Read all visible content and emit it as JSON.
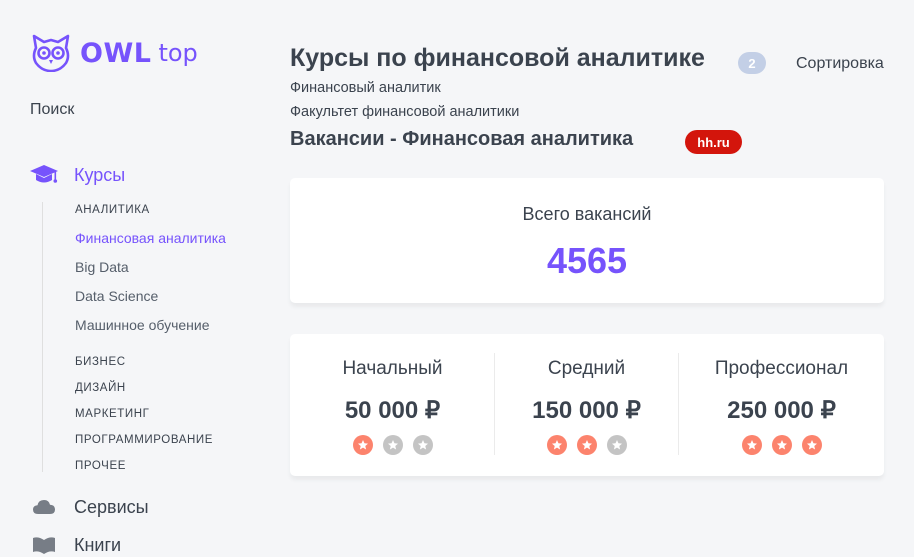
{
  "logo": {
    "owl": "OWL",
    "top": "top"
  },
  "search": {
    "label": "Поиск"
  },
  "nav": {
    "courses": "Курсы",
    "services": "Сервисы",
    "books": "Книги"
  },
  "subnav": {
    "analytics": "АНАЛИТИКА",
    "items": [
      "Финансовая аналитика",
      "Big Data",
      "Data Science",
      "Машинное обучение"
    ],
    "categories": [
      "БИЗНЕС",
      "ДИЗАЙН",
      "МАРКЕТИНГ",
      "ПРОГРАММИРОВАНИЕ",
      "ПРОЧЕЕ"
    ]
  },
  "header": {
    "title": "Курсы по финансовой аналитике",
    "count": "2",
    "sort": "Сортировка",
    "category1": "Финансовый аналитик",
    "category2": "Факультет финансовой аналитики",
    "vacancies_title": "Вакансии - Финансовая аналитика",
    "source_badge": "hh.ru"
  },
  "vacancies": {
    "label": "Всего вакансий",
    "count": "4565"
  },
  "salaries": [
    {
      "level": "Начальный",
      "value": "50 000 ₽",
      "rating": 1,
      "max": 3
    },
    {
      "level": "Средний",
      "value": "150 000 ₽",
      "rating": 2,
      "max": 3
    },
    {
      "level": "Профессионал",
      "value": "250 000 ₽",
      "rating": 3,
      "max": 3
    }
  ],
  "colors": {
    "accent": "#7653fc",
    "star_on": "#fc836d",
    "star_off": "#c4c4c4",
    "hh_red": "#d3150c"
  }
}
